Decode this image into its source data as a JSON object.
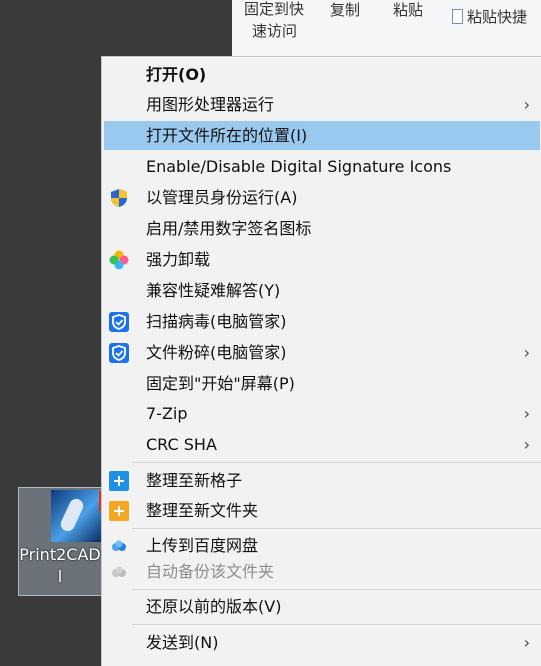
{
  "ribbon": {
    "pin_line1": "固定到快",
    "pin_line2": "速访问",
    "copy": "复制",
    "paste": "粘贴",
    "paste_shortcut": "粘贴快捷"
  },
  "desktop_icon": {
    "label": "Print2CAD\nl"
  },
  "menu": {
    "items": [
      {
        "label": "打开(O)"
      },
      {
        "label": "用图形处理器运行",
        "arrow": "›"
      },
      {
        "label": "打开文件所在的位置(I)"
      },
      {
        "label": "Enable/Disable Digital Signature Icons"
      },
      {
        "label": "以管理员身份运行(A)",
        "icon": "uac-shield-icon"
      },
      {
        "label": "启用/禁用数字签名图标"
      },
      {
        "label": "强力卸载",
        "icon": "uninstall-flower-icon"
      },
      {
        "label": "兼容性疑难解答(Y)"
      },
      {
        "label": "扫描病毒(电脑管家)",
        "icon": "tencent-shield-icon"
      },
      {
        "label": "文件粉碎(电脑管家)",
        "icon": "tencent-shield-icon",
        "arrow": "›"
      },
      {
        "label": "固定到\"开始\"屏幕(P)"
      },
      {
        "label": "7-Zip",
        "arrow": "›"
      },
      {
        "label": "CRC SHA",
        "arrow": "›"
      },
      {
        "label": "整理至新格子",
        "icon": "plus-blue-icon"
      },
      {
        "label": "整理至新文件夹",
        "icon": "plus-folder-icon"
      },
      {
        "label": "上传到百度网盘",
        "icon": "baidu-cloud-icon"
      },
      {
        "label": "自动备份该文件夹",
        "icon": "baidu-cloud-gray-icon"
      },
      {
        "label": "还原以前的版本(V)"
      },
      {
        "label": "发送到(N)",
        "arrow": "›"
      }
    ]
  },
  "colors": {
    "highlight": "#99c9ef",
    "menu_bg": "#f2f2f2",
    "desktop": "#3a3a3a"
  }
}
